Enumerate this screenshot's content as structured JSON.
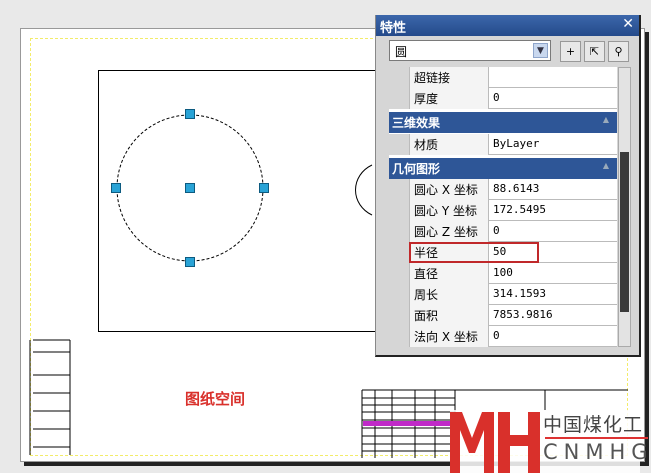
{
  "panel": {
    "title": "特性",
    "object_type": "圆",
    "close_icon": "close-icon",
    "rows_top": [
      {
        "label": "超链接",
        "value": ""
      },
      {
        "label": "厚度",
        "value": "0"
      }
    ],
    "section_3d": {
      "title": "三维效果",
      "rows": [
        {
          "label": "材质",
          "value": "ByLayer"
        }
      ]
    },
    "section_geom": {
      "title": "几何图形",
      "rows": [
        {
          "label": "圆心 X 坐标",
          "value": "88.6143"
        },
        {
          "label": "圆心 Y 坐标",
          "value": "172.5495"
        },
        {
          "label": "圆心 Z 坐标",
          "value": "0"
        },
        {
          "label": "半径",
          "value": "50"
        },
        {
          "label": "直径",
          "value": "100"
        },
        {
          "label": "周长",
          "value": "314.1593"
        },
        {
          "label": "面积",
          "value": "7853.9816"
        },
        {
          "label": "法向 X 坐标",
          "value": "0"
        }
      ]
    }
  },
  "drawing": {
    "paper_space_label": "图纸空间"
  },
  "watermark": {
    "cn": "中国煤化工",
    "en": "CNMHG",
    "mark": "MH"
  },
  "colors": {
    "accent": "#2e5697",
    "highlight": "#c0282a",
    "grip": "#29a3d6"
  }
}
